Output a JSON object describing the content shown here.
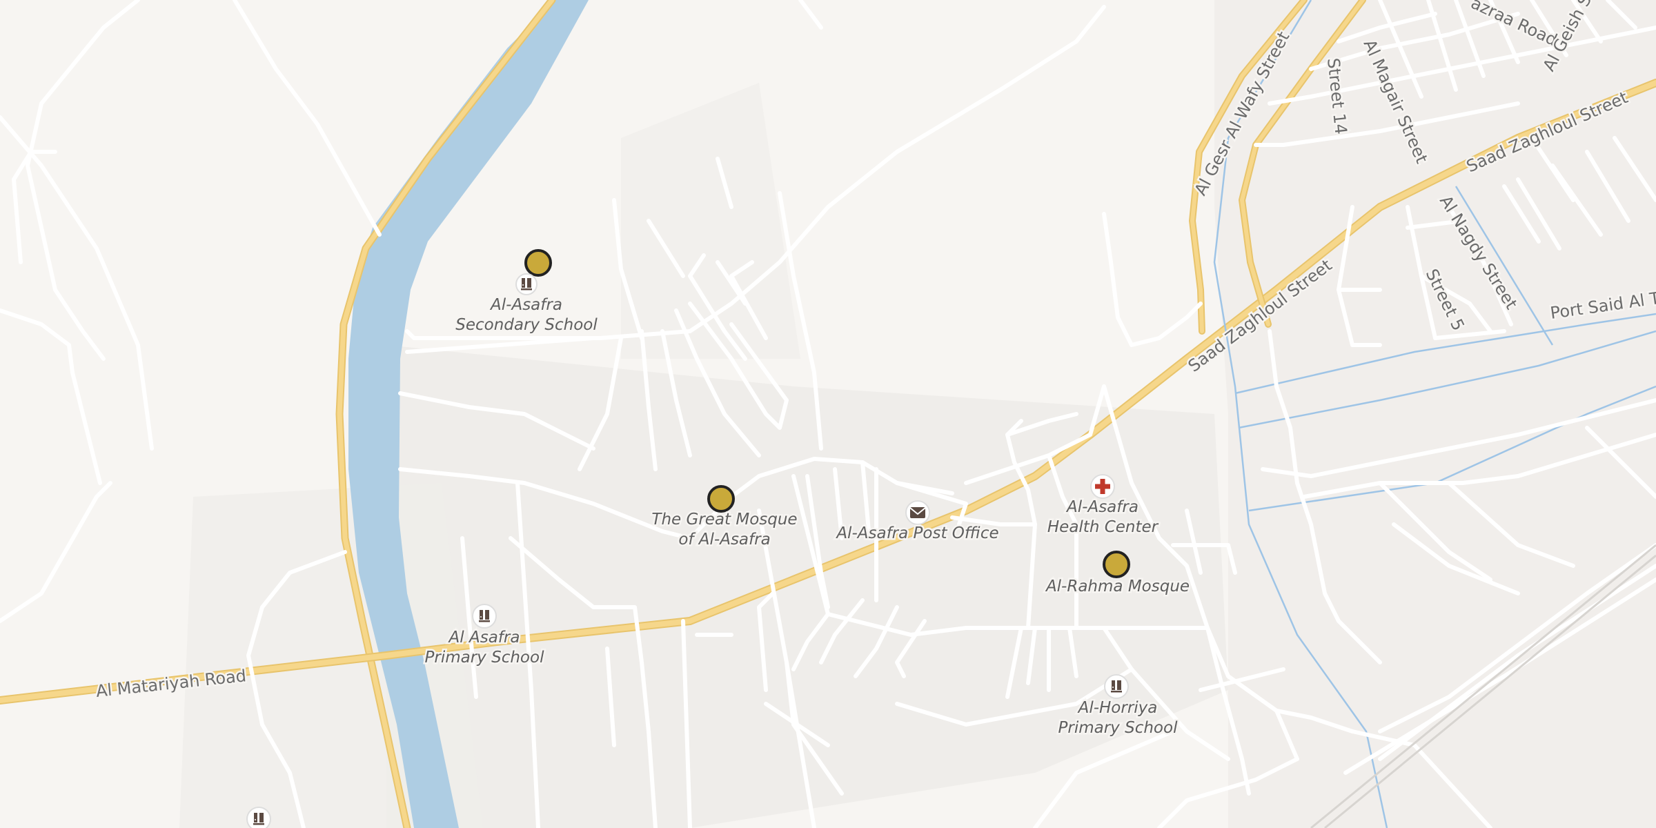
{
  "colors": {
    "land": "#f7f5f2",
    "urban": "#efedea",
    "water": "#aecde3",
    "road_main": "#f6d78b",
    "road_minor": "#ffffff",
    "stream": "#9ec4e6",
    "marker": "#c9a93a",
    "medical": "#c0392b"
  },
  "road_labels": {
    "al_matariyah": "Al Matariyah Road",
    "saad_zaghloul_1": "Saad Zaghloul Street",
    "saad_zaghloul_2": "Saad Zaghloul Street",
    "al_gesr_al_wafy": "Al Gesr Al Wafy Street",
    "street_14": "Street 14",
    "al_magair": "Al Magair Street",
    "al_nagdy": "Al Nagdy Street",
    "street_5": "Street 5",
    "port_said": "Port Said Al T",
    "mazraa": "azraa Road",
    "al_geish": "Al Geish St"
  },
  "pois": {
    "secondary_school": {
      "line1": "Al-Asafra",
      "line2": "Secondary School",
      "icon": "school-icon"
    },
    "great_mosque": {
      "line1": "The Great Mosque",
      "line2": "of Al-Asafra",
      "icon": "marker"
    },
    "post_office": {
      "line1": "Al-Asafra Post Office",
      "icon": "mail-icon"
    },
    "health_center": {
      "line1": "Al-Asafra",
      "line2": "Health Center",
      "icon": "medical-cross-icon"
    },
    "rahma_mosque": {
      "line1": "Al-Rahma Mosque",
      "icon": "marker"
    },
    "primary_school": {
      "line1": "Al Asafra",
      "line2": "Primary School",
      "icon": "school-icon"
    },
    "horriya_school": {
      "line1": "Al-Horriya",
      "line2": "Primary School",
      "icon": "school-icon"
    }
  }
}
